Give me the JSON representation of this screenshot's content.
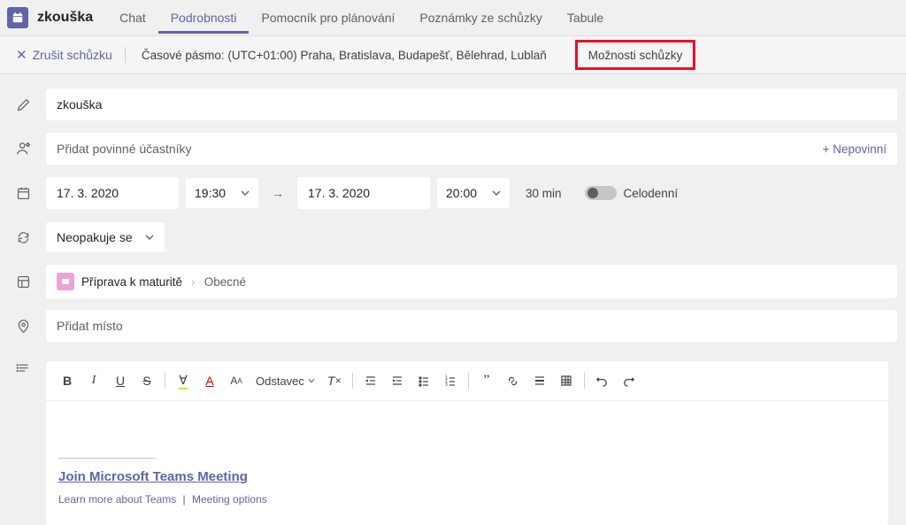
{
  "header": {
    "title": "zkouška",
    "tabs": {
      "chat": "Chat",
      "details": "Podrobnosti",
      "scheduling": "Pomocník pro plánování",
      "notes": "Poznámky ze schůzky",
      "whiteboard": "Tabule"
    }
  },
  "actionbar": {
    "cancel": "Zrušit schůzku",
    "timezone": "Časové pásmo: (UTC+01:00) Praha, Bratislava, Budapešť, Bělehrad, Lublaň",
    "meeting_options": "Možnosti schůzky"
  },
  "form": {
    "subject": "zkouška",
    "attendees_placeholder": "Přidat povinné účastníky",
    "optional": "+ Nepovinní",
    "start_date": "17. 3. 2020",
    "start_time": "19:30",
    "end_date": "17. 3. 2020",
    "end_time": "20:00",
    "duration": "30 min",
    "allday": "Celodenní",
    "repeat": "Neopakuje se",
    "channel_team": "Příprava k maturitě",
    "channel_name": "Obecné",
    "location_placeholder": "Přidat místo"
  },
  "rte": {
    "paragraph": "Odstavec",
    "join_link": "Join Microsoft Teams Meeting",
    "learn_more": "Learn more about Teams",
    "meeting_opts": "Meeting options"
  }
}
